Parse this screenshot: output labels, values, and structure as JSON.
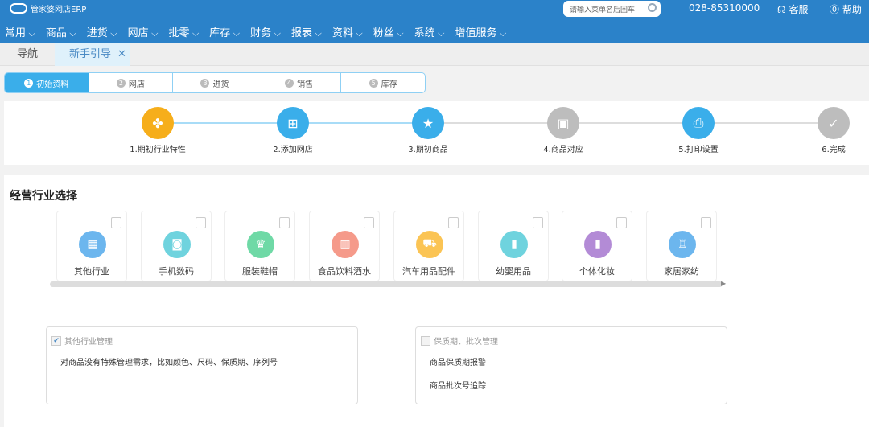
{
  "header": {
    "logo": "管家婆网店ERP",
    "search_placeholder": "请输入菜单名后回车",
    "phone": "028-85310000",
    "service": "客服",
    "help": "帮助"
  },
  "menu": [
    "常用",
    "商品",
    "进货",
    "网店",
    "批零",
    "库存",
    "财务",
    "报表",
    "资料",
    "粉丝",
    "系统",
    "增值服务"
  ],
  "tabs": {
    "nav": "导航",
    "guide": "新手引导",
    "close": "✕"
  },
  "steps": [
    {
      "n": "1",
      "label": "初始资料"
    },
    {
      "n": "2",
      "label": "网店"
    },
    {
      "n": "3",
      "label": "进货"
    },
    {
      "n": "4",
      "label": "销售"
    },
    {
      "n": "5",
      "label": "库存"
    }
  ],
  "progress": [
    {
      "label": "1.期初行业特性",
      "color": "#f6ae1b",
      "icon": "grid-icon",
      "glyph": "✤"
    },
    {
      "label": "2.添加网店",
      "color": "#3aaeea",
      "icon": "store-icon",
      "glyph": "⊞"
    },
    {
      "label": "3.期初商品",
      "color": "#3aaeea",
      "icon": "bag-icon",
      "glyph": "★"
    },
    {
      "label": "4.商品对应",
      "color": "#bdbdbd",
      "icon": "box-icon",
      "glyph": "▣"
    },
    {
      "label": "5.打印设置",
      "color": "#3aaeea",
      "icon": "printer-icon",
      "glyph": "⎙"
    },
    {
      "label": "6.完成",
      "color": "#bdbdbd",
      "icon": "checklist-icon",
      "glyph": "✓"
    }
  ],
  "section_title": "经营行业选择",
  "industries": [
    {
      "label": "其他行业",
      "color": "#6cb6ee",
      "glyph": "▦",
      "icon": "grid-icon"
    },
    {
      "label": "手机数码",
      "color": "#6fd3de",
      "glyph": "◙",
      "icon": "camera-icon"
    },
    {
      "label": "服装鞋帽",
      "color": "#6fd9a6",
      "glyph": "♛",
      "icon": "shirt-icon"
    },
    {
      "label": "食品饮料酒水",
      "color": "#f59a8a",
      "glyph": "▥",
      "icon": "beer-icon"
    },
    {
      "label": "汽车用品配件",
      "color": "#fbc454",
      "glyph": "⛟",
      "icon": "car-icon"
    },
    {
      "label": "幼婴用品",
      "color": "#6fd3de",
      "glyph": "▮",
      "icon": "bottle-icon"
    },
    {
      "label": "个体化妆",
      "color": "#b38bd6",
      "glyph": "▮",
      "icon": "lipstick-icon"
    },
    {
      "label": "家居家纺",
      "color": "#6cb6ee",
      "glyph": "♖",
      "icon": "sofa-icon"
    }
  ],
  "boxes": [
    {
      "title": "其他行业管理",
      "checked": true,
      "lines": [
        "对商品没有特殊管理需求，比如颜色、尺码、保质期、序列号"
      ]
    },
    {
      "title": "保质期、批次管理",
      "checked": false,
      "lines": [
        "商品保质期报警",
        "商品批次号追踪"
      ]
    }
  ]
}
